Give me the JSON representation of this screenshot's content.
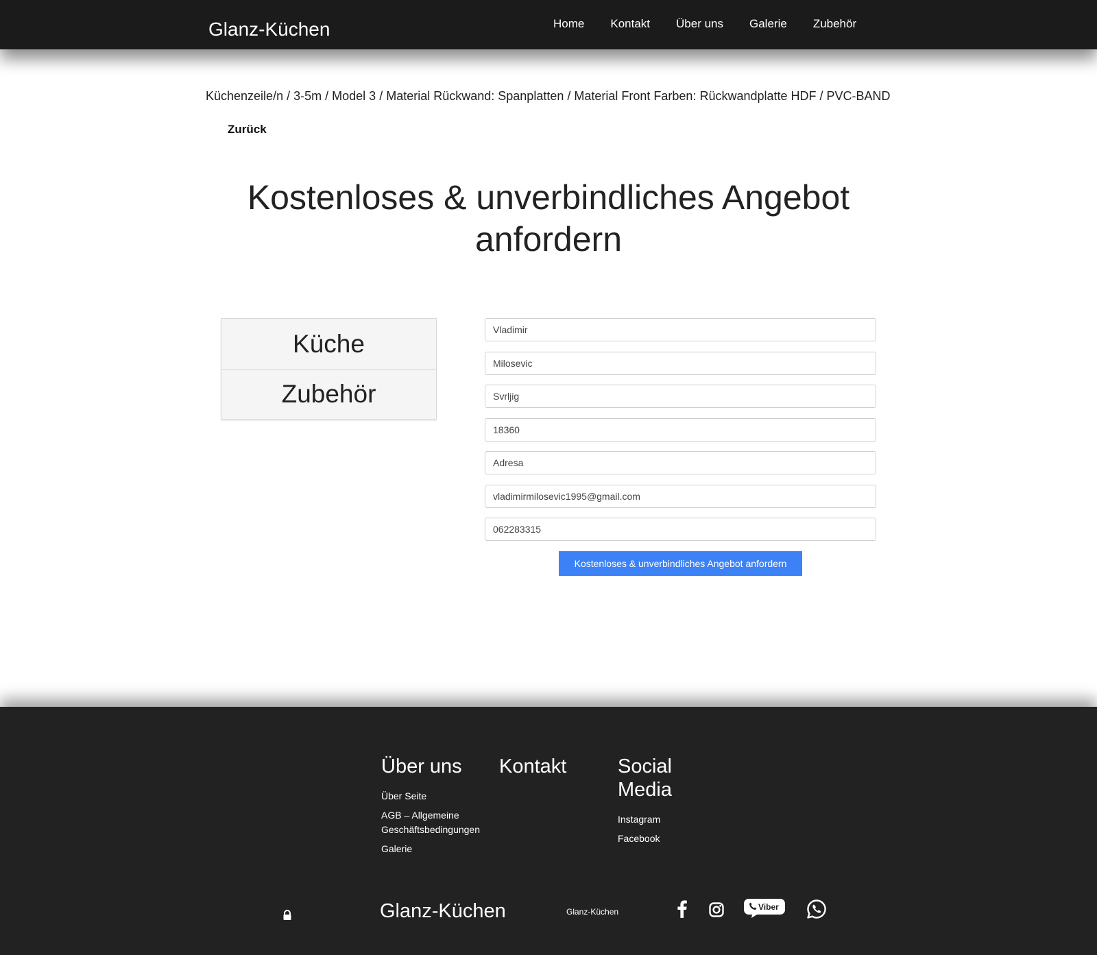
{
  "header": {
    "brand": "Glanz-Küchen",
    "nav": [
      "Home",
      "Kontakt",
      "Über uns",
      "Galerie",
      "Zubehör"
    ]
  },
  "breadcrumb": [
    "Küchenzeile/n",
    "3-5m",
    "Model 3",
    "Material Rückwand: Spanplatten",
    "Material Front Farben: Rückwandplatte HDF",
    "PVC-BAND"
  ],
  "back_label": "Zurück",
  "headline": "Kostenloses & unverbindliches Angebot anfordern",
  "categories": [
    "Küche",
    "Zubehör"
  ],
  "form": {
    "fields": [
      "Vladimir",
      "Milosevic",
      "Svrljig",
      "18360",
      "Adresa",
      "vladimirmilosevic1995@gmail.com",
      "062283315"
    ],
    "submit_label": "Kostenloses & unverbindliches Angebot anfordern"
  },
  "footer": {
    "about_title": "Über uns",
    "about_links": [
      "Über Seite",
      "AGB – Allgemeine Geschäftsbedingungen",
      "Galerie"
    ],
    "contact_title": "Kontakt",
    "social_title": "Social Media",
    "social_links": [
      "Instagram",
      "Facebook"
    ],
    "brand": "Glanz-Küchen",
    "small_brand": "Glanz-Küchen",
    "icons": [
      "lock-icon",
      "facebook-icon",
      "instagram-icon",
      "viber-icon",
      "whatsapp-icon"
    ],
    "viber_label": "Viber"
  },
  "colors": {
    "header_bg": "#1b1b1b",
    "footer_bg": "#222222",
    "button": "#3c82f6"
  }
}
